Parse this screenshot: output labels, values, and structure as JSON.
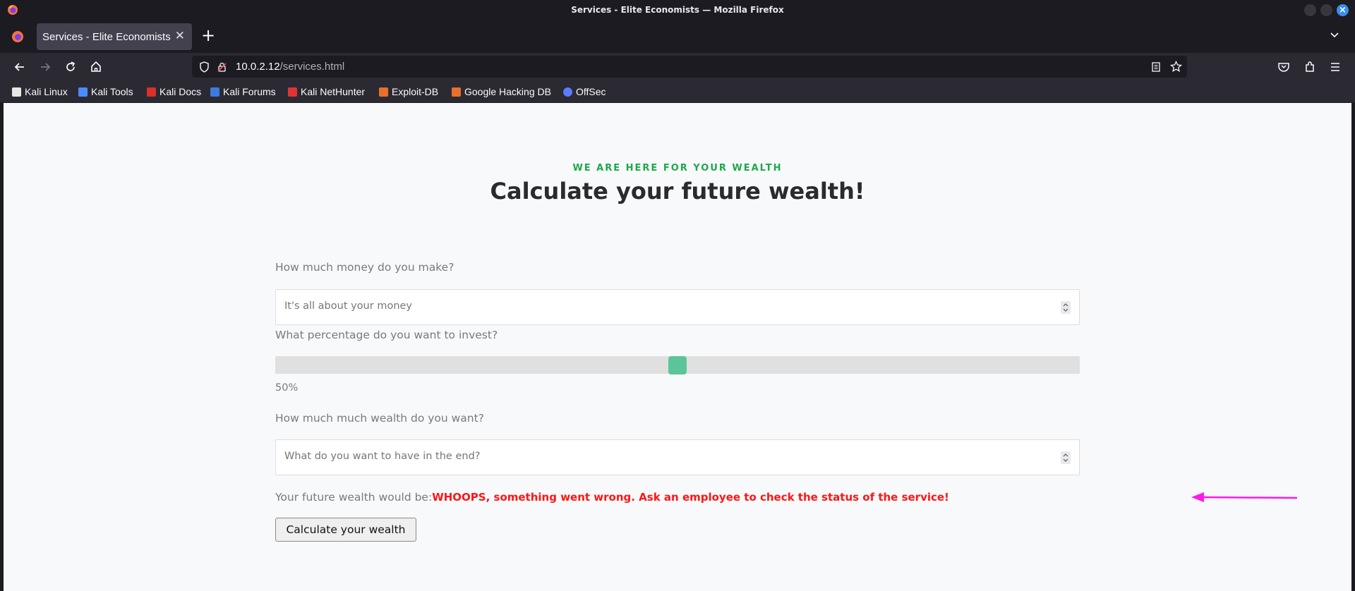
{
  "window": {
    "title": "Services - Elite Economists — Mozilla Firefox"
  },
  "tabs": [
    {
      "label": "Services - Elite Economists",
      "active": true
    }
  ],
  "urlbar": {
    "host": "10.0.2.12",
    "path": "/services.html"
  },
  "bookmarks": [
    {
      "label": "Kali Linux",
      "icon": "kali-dragon-icon",
      "color": "#e6e6e6"
    },
    {
      "label": "Kali Tools",
      "icon": "kali-tools-icon",
      "color": "#4a8cff"
    },
    {
      "label": "Kali Docs",
      "icon": "kali-docs-icon",
      "color": "#d9312b"
    },
    {
      "label": "Kali Forums",
      "icon": "kali-forums-icon",
      "color": "#3d7be0"
    },
    {
      "label": "Kali NetHunter",
      "icon": "kali-nethunter-icon",
      "color": "#e03434"
    },
    {
      "label": "Exploit-DB",
      "icon": "exploit-db-icon",
      "color": "#e8702a"
    },
    {
      "label": "Google Hacking DB",
      "icon": "ghdb-icon",
      "color": "#e8702a"
    },
    {
      "label": "OffSec",
      "icon": "offsec-icon",
      "color": "#5a7cff"
    }
  ],
  "page": {
    "eyebrow": "WE ARE HERE FOR YOUR WEALTH",
    "headline": "Calculate your future wealth!",
    "money_label": "How much money do you make?",
    "money_placeholder": "It's all about your money",
    "percent_label": "What percentage do you want to invest?",
    "percent_value": 50,
    "percent_text": "50%",
    "wealth_label": "How much much wealth do you want?",
    "wealth_placeholder": "What do you want to have in the end?",
    "result_label": "Your future wealth would be:",
    "result_error": "WHOOPS, something went wrong. Ask an employee to check the status of the service!",
    "calculate_button": "Calculate your wealth"
  },
  "colors": {
    "accent_green": "#1ea84a",
    "slider_thumb": "#5bc59a",
    "error_red": "#ff1515",
    "annotation_arrow": "#ff18e8"
  }
}
